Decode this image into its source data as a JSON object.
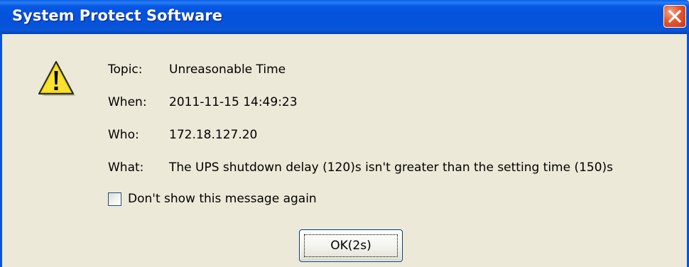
{
  "window": {
    "title": "System Protect Software"
  },
  "message": {
    "topic_label": "Topic:",
    "topic_value": "Unreasonable Time",
    "when_label": "When:",
    "when_value": "2011-11-15 14:49:23",
    "who_label": "Who:",
    "who_value": "172.18.127.20",
    "what_label": "What:",
    "what_value": "The UPS shutdown delay (120)s isn't greater than the setting time (150)s"
  },
  "checkbox": {
    "label": "Don't show this message again",
    "checked": false
  },
  "ok_button": {
    "label": "OK(2s)"
  },
  "icons": {
    "warning": "warning-icon",
    "close": "close-icon"
  },
  "colors": {
    "titlebar": "#0552db",
    "close_button": "#e4562c",
    "dialog_background": "#ece9d8",
    "warning_yellow": "#f5d90a"
  }
}
